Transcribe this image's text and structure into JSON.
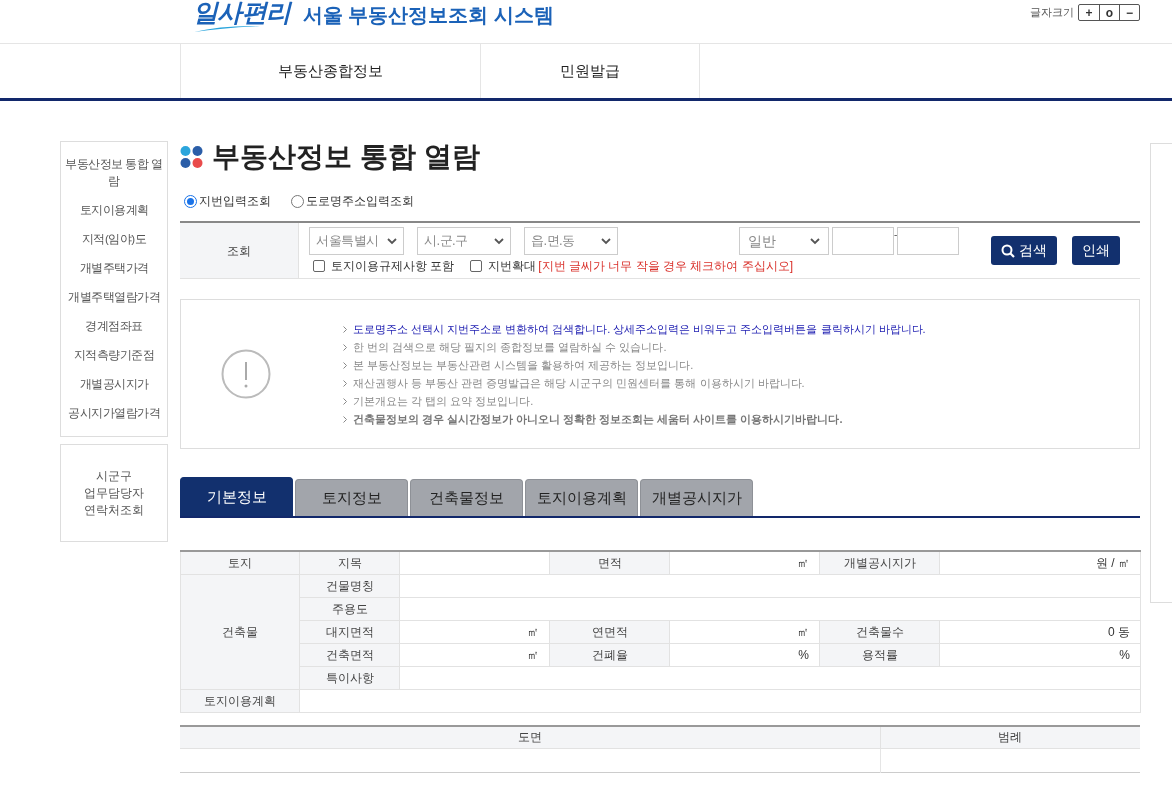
{
  "header": {
    "logo_text": "일사편리",
    "system_title": "서울 부동산정보조회 시스템",
    "font_size_label": "글자크기",
    "font_size_buttons": [
      "+",
      "o",
      "−"
    ]
  },
  "nav": [
    {
      "label": "부동산종합정보"
    },
    {
      "label": "민원발급"
    }
  ],
  "sidebar": {
    "items": [
      "부동산정보 통합 열람",
      "토지이용계획",
      "지적(임야)도",
      "개별주택가격",
      "개별주택열람가격",
      "경계점좌표",
      "지적측량기준점",
      "개별공시지가",
      "공시지가열람가격"
    ],
    "contact_lines": [
      "시군구",
      "업무담당자",
      "연락처조회"
    ]
  },
  "page_title": "부동산정보 통합 열람",
  "search_modes": [
    {
      "label": "지번입력조회",
      "selected": true
    },
    {
      "label": "도로명주소입력조회",
      "selected": false
    }
  ],
  "search": {
    "label": "조회",
    "selects": [
      "서울특별시",
      "시.군.구",
      "읍.면.동"
    ],
    "type_select": "일반",
    "separator": "-",
    "checkboxes": [
      {
        "label": "토지이용규제사항 포함",
        "checked": false
      },
      {
        "label": "지번확대",
        "checked": false,
        "note": "[지번 글씨가 너무 작을 경우 체크하여 주십시오]"
      }
    ],
    "buttons": [
      {
        "label": "검색",
        "kind": "search"
      },
      {
        "label": "인쇄",
        "kind": "plain"
      }
    ]
  },
  "notices": [
    {
      "text": "도로명주소 선택시 지번주소로 변환하여 검색합니다. 상세주소입력은 비워두고 주소입력버튼을 클릭하시기 바랍니다.",
      "kind": "highlight"
    },
    {
      "text": "한 번의 검색으로 해당 필지의 종합정보를 열람하실 수 있습니다.",
      "kind": "normal"
    },
    {
      "text": "본 부동산정보는 부동산관련 시스템을 활용하여 제공하는 정보입니다.",
      "kind": "normal"
    },
    {
      "text": "재산권행사 등 부동산 관련 증명발급은 해당 시군구의 민원센터를 통해 이용하시기 바랍니다.",
      "kind": "normal"
    },
    {
      "text": "기본개요는 각 탭의 요약 정보입니다.",
      "kind": "normal"
    },
    {
      "text": "건축물정보의 경우 실시간정보가 아니오니 정확한 정보조회는 세움터 사이트를 이용하시기바랍니다.",
      "kind": "bold"
    }
  ],
  "tabs": [
    {
      "label": "기본정보",
      "selected": true
    },
    {
      "label": "토지정보",
      "selected": false
    },
    {
      "label": "건축물정보",
      "selected": false
    },
    {
      "label": "토지이용계획",
      "selected": false
    },
    {
      "label": "개별공시지가",
      "selected": false
    }
  ],
  "info_table": {
    "rows": [
      [
        {
          "text": "토지",
          "kind": "header"
        },
        {
          "text": "지목",
          "kind": "header"
        },
        {
          "kind": "value"
        },
        {
          "text": "면적",
          "kind": "header"
        },
        {
          "text": "㎡",
          "kind": "value"
        },
        {
          "text": "개별공시지가",
          "kind": "header"
        },
        {
          "text": "원 / ㎡",
          "kind": "value"
        }
      ],
      [
        {
          "text": "건축물",
          "kind": "header",
          "rowspan": 5
        },
        {
          "text": "건물명칭",
          "kind": "header"
        },
        {
          "kind": "value",
          "colspan": 5
        }
      ],
      [
        {
          "text": "주용도",
          "kind": "header"
        },
        {
          "kind": "value",
          "colspan": 5
        }
      ],
      [
        {
          "text": "대지면적",
          "kind": "header"
        },
        {
          "text": "㎡",
          "kind": "value"
        },
        {
          "text": "연면적",
          "kind": "header"
        },
        {
          "text": "㎡",
          "kind": "value"
        },
        {
          "text": "건축물수",
          "kind": "header"
        },
        {
          "text": "0 동",
          "kind": "value"
        }
      ],
      [
        {
          "text": "건축면적",
          "kind": "header"
        },
        {
          "text": "㎡",
          "kind": "value"
        },
        {
          "text": "건폐율",
          "kind": "header"
        },
        {
          "text": "%",
          "kind": "value"
        },
        {
          "text": "용적률",
          "kind": "header"
        },
        {
          "text": "%",
          "kind": "value"
        }
      ],
      [
        {
          "text": "특이사항",
          "kind": "header"
        },
        {
          "kind": "value",
          "colspan": 5
        }
      ],
      [
        {
          "text": "토지이용계획",
          "kind": "header"
        },
        {
          "kind": "value",
          "colspan": 6
        }
      ]
    ]
  },
  "drawing_table": {
    "columns": [
      "도면",
      "범례"
    ]
  }
}
